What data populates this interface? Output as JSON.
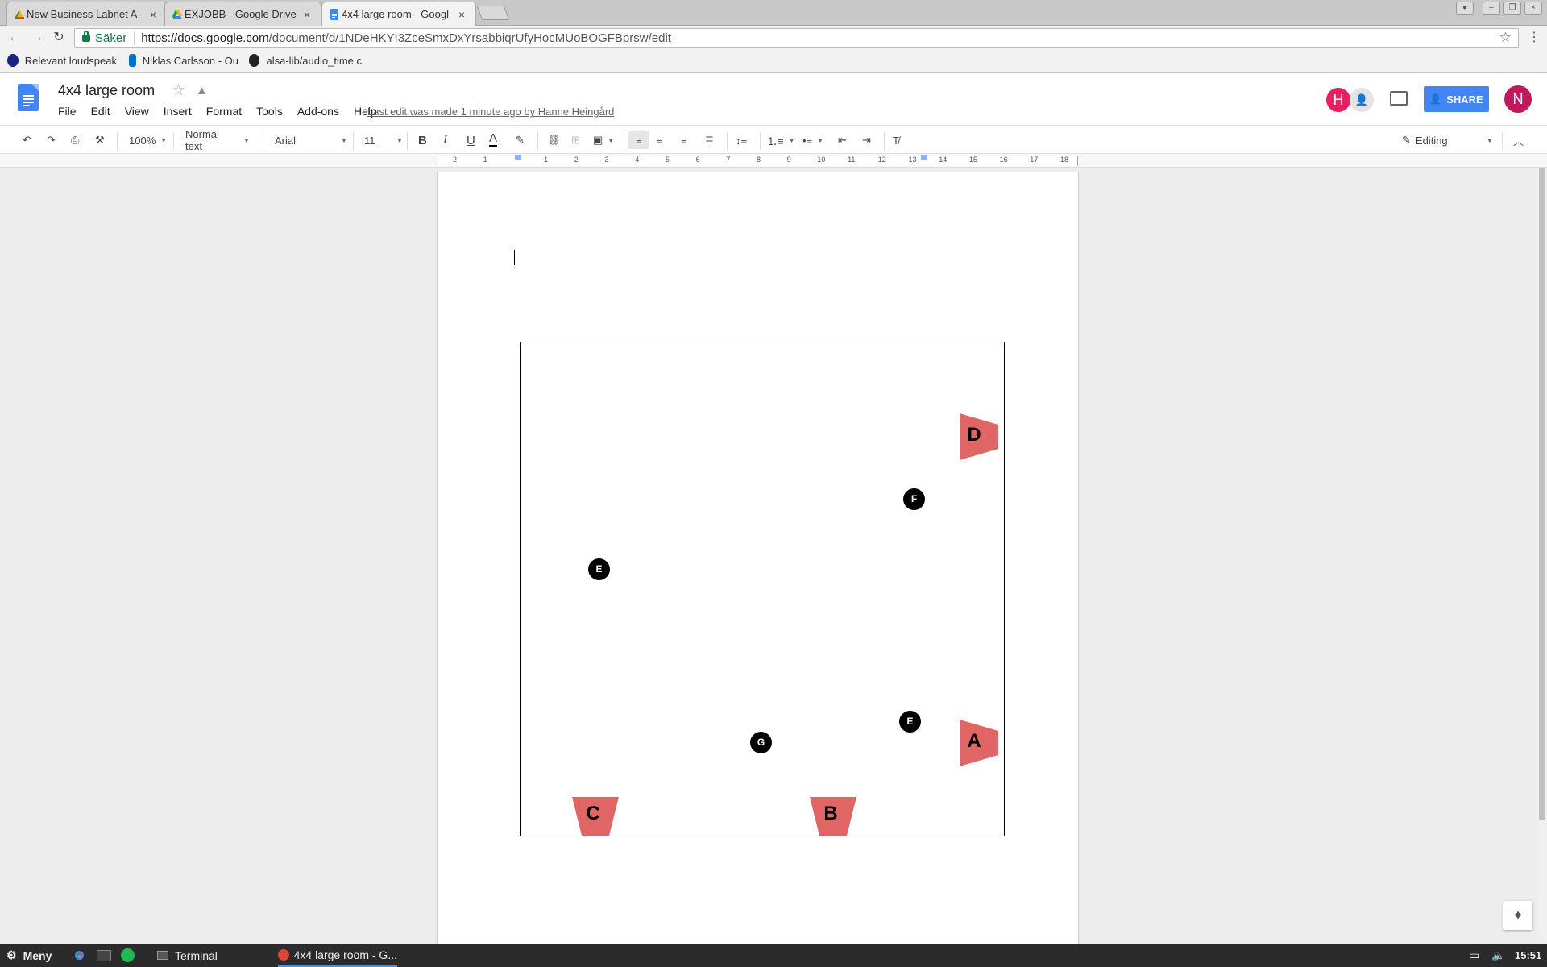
{
  "browser": {
    "tabs": [
      {
        "title": "New Business Labnet A",
        "icon": "google-drive-yellow-icon"
      },
      {
        "title": "EXJOBB - Google Drive",
        "icon": "google-drive-icon"
      },
      {
        "title": "4x4 large room - Googl",
        "icon": "google-docs-icon"
      }
    ],
    "secure_label": "Säker",
    "url_host": "https://docs.google.com",
    "url_path": "/document/d/1NDeHKYI3ZceSmxDxYrsabbiqrUfyHocMUoBOGFBprsw/edit",
    "bookmarks": [
      {
        "label": "Relevant loudspeak",
        "icon": "bk-icon"
      },
      {
        "label": "Niklas Carlsson - Ou",
        "icon": "outlook-icon"
      },
      {
        "label": "alsa-lib/audio_time.c",
        "icon": "github-icon"
      }
    ]
  },
  "doc": {
    "title": "4x4 large room",
    "menu": [
      "File",
      "Edit",
      "View",
      "Insert",
      "Format",
      "Tools",
      "Add-ons",
      "Help"
    ],
    "last_edit": "Last edit was made 1 minute ago by Hanne Heingård",
    "share_label": "SHARE",
    "avatar_h": "H",
    "avatar_n": "N",
    "colors": {
      "accent": "#4285f4",
      "speaker": "#e06666",
      "avatar_h": "#e91e63",
      "avatar_n": "#c2185b"
    }
  },
  "toolbar": {
    "zoom": "100%",
    "style": "Normal text",
    "font": "Arial",
    "size": "11",
    "mode": "Editing"
  },
  "ruler": {
    "labels": [
      "2",
      "1",
      "",
      "1",
      "2",
      "3",
      "4",
      "5",
      "6",
      "7",
      "8",
      "9",
      "10",
      "11",
      "12",
      "13",
      "14",
      "15",
      "16",
      "17",
      "18"
    ]
  },
  "drawing": {
    "speakers": [
      "D",
      "A",
      "C",
      "B"
    ],
    "nodes": [
      "F",
      "E",
      "E",
      "G"
    ]
  },
  "taskbar": {
    "menu_label": "Meny",
    "terminal_label": "Terminal",
    "window_label": "4x4 large room - G...",
    "clock": "15:51"
  }
}
